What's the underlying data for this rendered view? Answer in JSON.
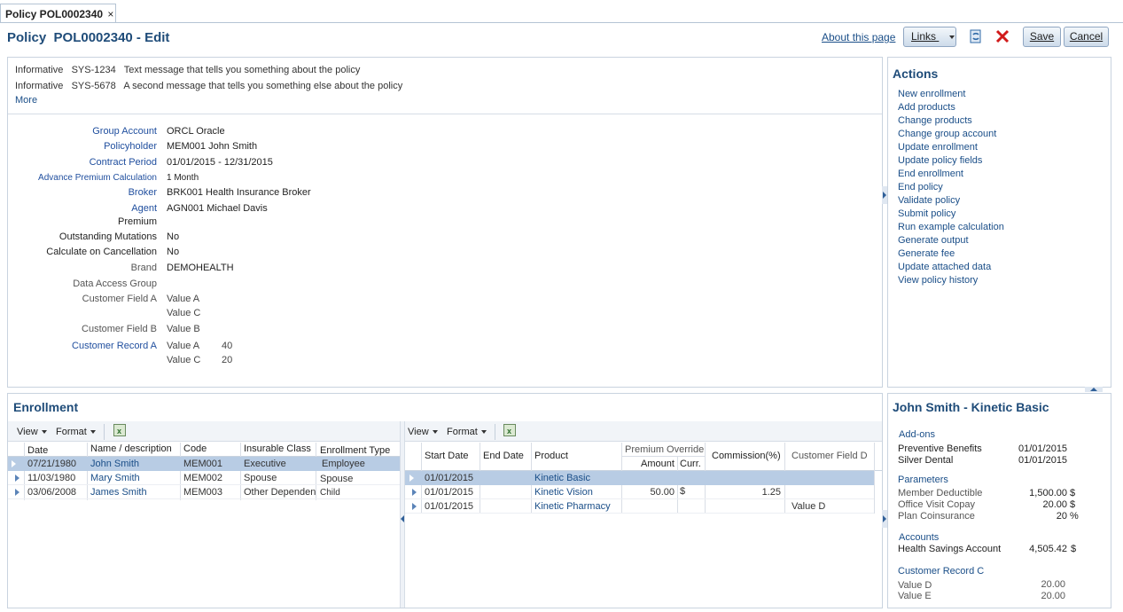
{
  "tab": {
    "title": "Policy POL0002340",
    "close": "×"
  },
  "page": {
    "title": "Policy  POL0002340 - Edit"
  },
  "toolbar": {
    "about": "About this page",
    "links": "Links",
    "save": "Save",
    "cancel": "Cancel"
  },
  "messages": [
    {
      "type": "Informative",
      "code": "SYS-1234",
      "text": "Text message that tells you something about the policy"
    },
    {
      "type": "Informative",
      "code": "SYS-5678",
      "text": "A second message that tells you something else about the policy"
    }
  ],
  "messages_more": "More",
  "fields": {
    "group_account": {
      "label": "Group Account",
      "value": "ORCL Oracle"
    },
    "policyholder": {
      "label": "Policyholder",
      "value": "MEM001 John Smith"
    },
    "contract_period": {
      "label": "Contract Period",
      "value": "01/01/2015 - 12/31/2015"
    },
    "advance_premium": {
      "label": "Advance Premium Calculation",
      "value": "1 Month"
    },
    "broker": {
      "label": "Broker",
      "value": "BRK001 Health Insurance Broker"
    },
    "agent": {
      "label": "Agent",
      "value": "AGN001 Michael Davis"
    },
    "premium": {
      "label": "Premium",
      "value": ""
    },
    "outstanding": {
      "label": "Outstanding Mutations",
      "value": "No"
    },
    "calc_cancel": {
      "label": "Calculate on Cancellation",
      "value": "No"
    },
    "brand": {
      "label": "Brand",
      "value": "DEMOHEALTH"
    },
    "data_access": {
      "label": "Data Access Group",
      "value": ""
    },
    "custom_a": {
      "label": "Customer Field A",
      "values": [
        "Value A",
        "Value C"
      ]
    },
    "custom_b": {
      "label": "Customer Field B",
      "value": "Value B"
    },
    "custom_rec_a": {
      "label": "Customer Record A",
      "rows": [
        {
          "k": "Value A",
          "v": "40"
        },
        {
          "k": "Value C",
          "v": "20"
        }
      ]
    }
  },
  "actions": {
    "title": "Actions",
    "items": [
      "New enrollment",
      "Add products",
      "Change products",
      "Change group account",
      "Update enrollment",
      "Update policy fields",
      "End enrollment",
      "End policy",
      "Validate policy",
      "Submit policy",
      "Run example calculation",
      "Generate output",
      "Generate fee",
      "Update attached data",
      "View policy history"
    ]
  },
  "enrollment": {
    "title": "Enrollment",
    "view": "View",
    "format": "Format",
    "columns": [
      "Date",
      "Name / description",
      "Code",
      "Insurable Class",
      "Enrollment Type"
    ],
    "rows": [
      [
        "07/21/1980",
        "John Smith",
        "MEM001",
        "Executive",
        "Employee"
      ],
      [
        "11/03/1980",
        "Mary Smith",
        "MEM002",
        "Spouse",
        "Spouse"
      ],
      [
        "03/06/2008",
        "James Smith",
        "MEM003",
        "Other Dependen",
        "Child"
      ]
    ]
  },
  "products": {
    "view": "View",
    "format": "Format",
    "columns": {
      "start": "Start Date",
      "end": "End Date",
      "product": "Product",
      "override": "Premium Override",
      "amount": "Amount",
      "curr": "Curr.",
      "commission": "Commission(%)",
      "custom_d": "Customer Field D"
    },
    "rows": [
      {
        "start": "01/01/2015",
        "end": "",
        "product": "Kinetic Basic",
        "amount": "",
        "curr": "",
        "commission": "",
        "custom_d": ""
      },
      {
        "start": "01/01/2015",
        "end": "",
        "product": "Kinetic Vision",
        "amount": "50.00",
        "curr": "$",
        "commission": "1.25",
        "custom_d": ""
      },
      {
        "start": "01/01/2015",
        "end": "",
        "product": "Kinetic Pharmacy",
        "amount": "",
        "curr": "",
        "commission": "",
        "custom_d": "Value D"
      }
    ]
  },
  "detail": {
    "title": "John Smith - Kinetic Basic",
    "addons_title": "Add-ons",
    "addons": [
      {
        "name": "Preventive Benefits",
        "date": "01/01/2015"
      },
      {
        "name": "Silver Dental",
        "date": "01/01/2015"
      }
    ],
    "params_title": "Parameters",
    "params": [
      {
        "name": "Member Deductible",
        "value": "1,500.00",
        "unit": "$"
      },
      {
        "name": "Office Visit Copay",
        "value": "20.00",
        "unit": "$"
      },
      {
        "name": "Plan Coinsurance",
        "value": "20",
        "unit": "%"
      }
    ],
    "accounts_title": "Accounts",
    "accounts": [
      {
        "name": "Health Savings Account",
        "value": "4,505.42",
        "unit": "$"
      }
    ],
    "custom_title": "Customer Record C",
    "custom": [
      {
        "name": "Value D",
        "value": "20.00"
      },
      {
        "name": "Value E",
        "value": "20.00"
      }
    ]
  }
}
